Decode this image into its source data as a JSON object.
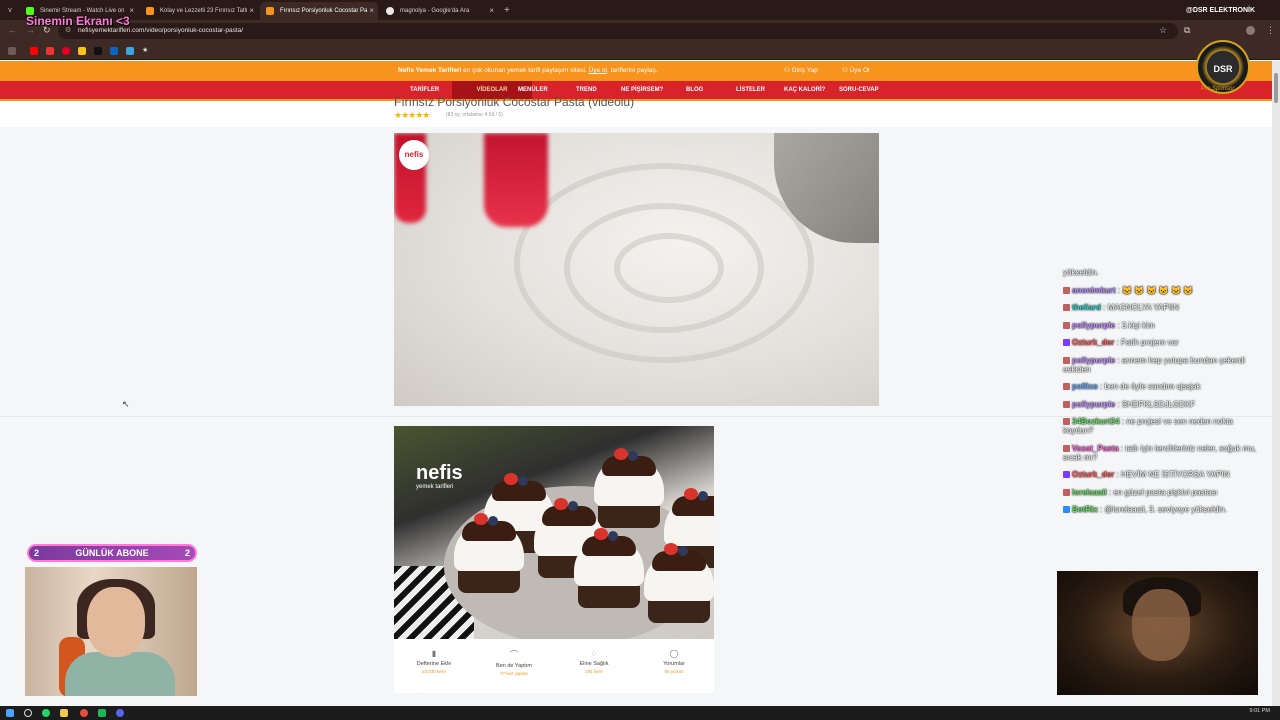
{
  "overlay": {
    "stream_title": "Sinemin Ekranı <3",
    "sponsor_handle": "@DSR ELEKTRONİK",
    "sponsor_logo_text": "DSR",
    "sponsor_sub": "Pro Sponsor"
  },
  "browser": {
    "tabs": [
      {
        "title": "Sinemir Stream - Watch Live on",
        "color": "#53fc18"
      },
      {
        "title": "Kolay ve Lezzetli 23 Fırınsız Tatlı",
        "color": "#f7941d"
      },
      {
        "title": "Fırınsız Porsiyonluk Cocostar Pa",
        "color": "#f7941d",
        "active": true
      },
      {
        "title": "magnolya - Google'da Ara",
        "color": "#e8e8e8"
      }
    ],
    "url": "nefisyemektarifleri.com/video/porsiyonluk-cocostar-pasta/"
  },
  "site": {
    "promo_brand": "Nefis Yemek Tarifleri",
    "promo_text": " en çok okunan yemek tarifi paylaşım sitesi. ",
    "promo_link": "Üye ol",
    "promo_tail": ", tariflerini paylaş.",
    "login": "Giriş Yap",
    "register": "Üye Ol",
    "nav": [
      "TARİFLER",
      "VİDEOLAR",
      "MENÜLER",
      "TREND",
      "NE PİŞİRSEM?",
      "BLOG",
      "LİSTELER",
      "KAÇ KALORİ?",
      "SORU-CEVAP"
    ],
    "page_title": "Fırınsız Porsiyonluk Cocostar Pasta (videolu)",
    "stars": "★★★★★",
    "rating_text": "(83 oy, ortalama: 4.59 / 5)",
    "video_logo": "nefis",
    "photo_logo": "nefis",
    "photo_logo_sub": "yemek tarifleri",
    "actions": [
      {
        "icon": "▮",
        "label": "Defterine Ekle",
        "sub": "23.030 kere"
      },
      {
        "icon": "⌒",
        "label": "Ben de Yaptım",
        "sub": "77 kez yapıldı"
      },
      {
        "icon": "◌",
        "label": "Eline Sağlık",
        "sub": "291 kere"
      },
      {
        "icon": "◯",
        "label": "Yorumlar",
        "sub": "85 yorum"
      }
    ]
  },
  "chat": [
    {
      "user": "",
      "color": "#fff",
      "text": "yükseldin."
    },
    {
      "user": "anonimkurt",
      "color": "#b18cff",
      "text": " : 🐱 🐱 🐱 🐱 🐱 🐱"
    },
    {
      "user": "theliard",
      "color": "#2bd1c4",
      "text": " : MAGNOLYA YAPIIN"
    },
    {
      "user": "pollypurple",
      "color": "#c38cff",
      "text": " : 3.kişi kim"
    },
    {
      "user": "Ozturk_der",
      "color": "#ff5a5a",
      "text": " : Fatih projem var"
    },
    {
      "user": "pollypurple",
      "color": "#c38cff",
      "text": " : annem hep yutupa bundan çekerdi eskiden"
    },
    {
      "user": "pollixo",
      "color": "#6aa7ff",
      "text": " : ben de öyle sandım sjssjak"
    },
    {
      "user": "pollypurple",
      "color": "#c38cff",
      "text": " : SHDFKLSDJLGDKF"
    },
    {
      "user": "34Bozkurt34",
      "color": "#6ae36a",
      "text": " : ne projesi ve sen neden nokta koydun?"
    },
    {
      "user": "Vasat_Pasta",
      "color": "#ff6ad9",
      "text": " : tatlı için tercihleriniz neler, soğuk mu, sıcak mı?"
    },
    {
      "user": "Ozturk_der",
      "color": "#ff5a5a",
      "text": " : HEVİM NE İSTİYORSA YAPIN"
    },
    {
      "user": "lorelaaaii",
      "color": "#6ae36a",
      "text": " : en güzel pasta pişkivi pastası"
    },
    {
      "user": "BotRix",
      "color": "#6ae36a",
      "text": " : @lorelaaaii, 3. seviyeye yükseldin."
    }
  ],
  "widget": {
    "label": "GÜNLÜK ABONE",
    "left_count": "2",
    "right_count": "2"
  },
  "taskbar": {
    "time": "9:01 PM"
  }
}
